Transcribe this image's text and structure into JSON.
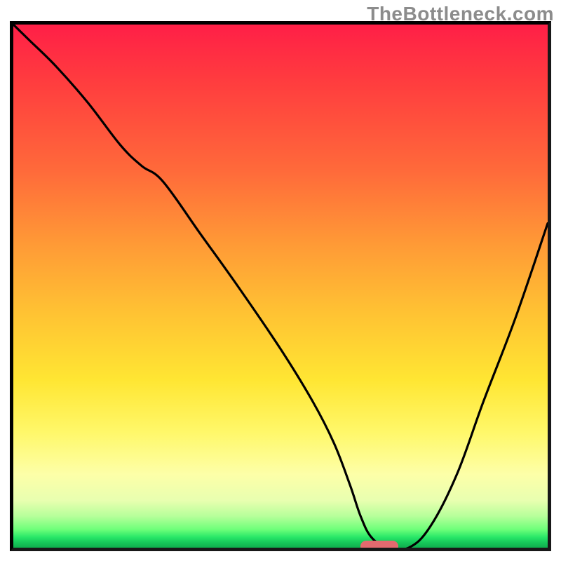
{
  "watermark": "TheBottleneck.com",
  "chart_data": {
    "type": "line",
    "title": "",
    "xlabel": "",
    "ylabel": "",
    "xlim": [
      0,
      100
    ],
    "ylim": [
      0,
      100
    ],
    "grid": false,
    "legend": false,
    "background": {
      "type": "vertical-gradient",
      "stops": [
        {
          "pct": 0,
          "color": "#ff1f47"
        },
        {
          "pct": 28,
          "color": "#ff6a3a"
        },
        {
          "pct": 55,
          "color": "#ffc233"
        },
        {
          "pct": 78,
          "color": "#fff86a"
        },
        {
          "pct": 94,
          "color": "#b6ff9a"
        },
        {
          "pct": 100,
          "color": "#0fae4e"
        }
      ]
    },
    "series": [
      {
        "name": "bottleneck-curve",
        "color": "#000000",
        "x": [
          0,
          3,
          8,
          14,
          20,
          24,
          28,
          35,
          42,
          50,
          56,
          60,
          63,
          65,
          67,
          70,
          74,
          78,
          83,
          88,
          94,
          100
        ],
        "y": [
          100,
          97,
          92,
          85,
          77,
          73,
          70,
          60,
          50,
          38,
          28,
          20,
          12,
          6,
          2,
          0,
          0,
          4,
          14,
          28,
          44,
          62
        ]
      }
    ],
    "markers": [
      {
        "name": "optimal-zone",
        "shape": "rounded-rect",
        "color": "#e36a6f",
        "x_range": [
          65,
          72
        ],
        "y": 0
      }
    ]
  }
}
